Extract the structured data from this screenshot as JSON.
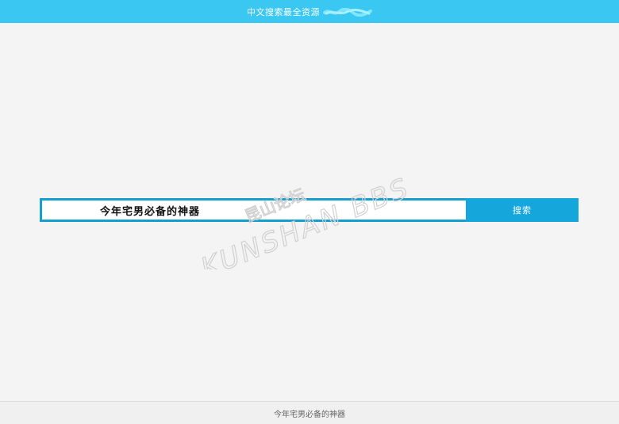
{
  "header": {
    "title": "中文搜索最全资源"
  },
  "search": {
    "value": "今年宅男必备的神器",
    "button_label": "搜索"
  },
  "watermark": {
    "line1": "昆山论坛",
    "line2": "KUNSHAN BBS"
  },
  "footer": {
    "text": "今年宅男必备的神器"
  },
  "colors": {
    "header_bg": "#3ac7f2",
    "search_border": "#159fcf",
    "search_button": "#15a6dc",
    "background": "#f4f4f4"
  }
}
